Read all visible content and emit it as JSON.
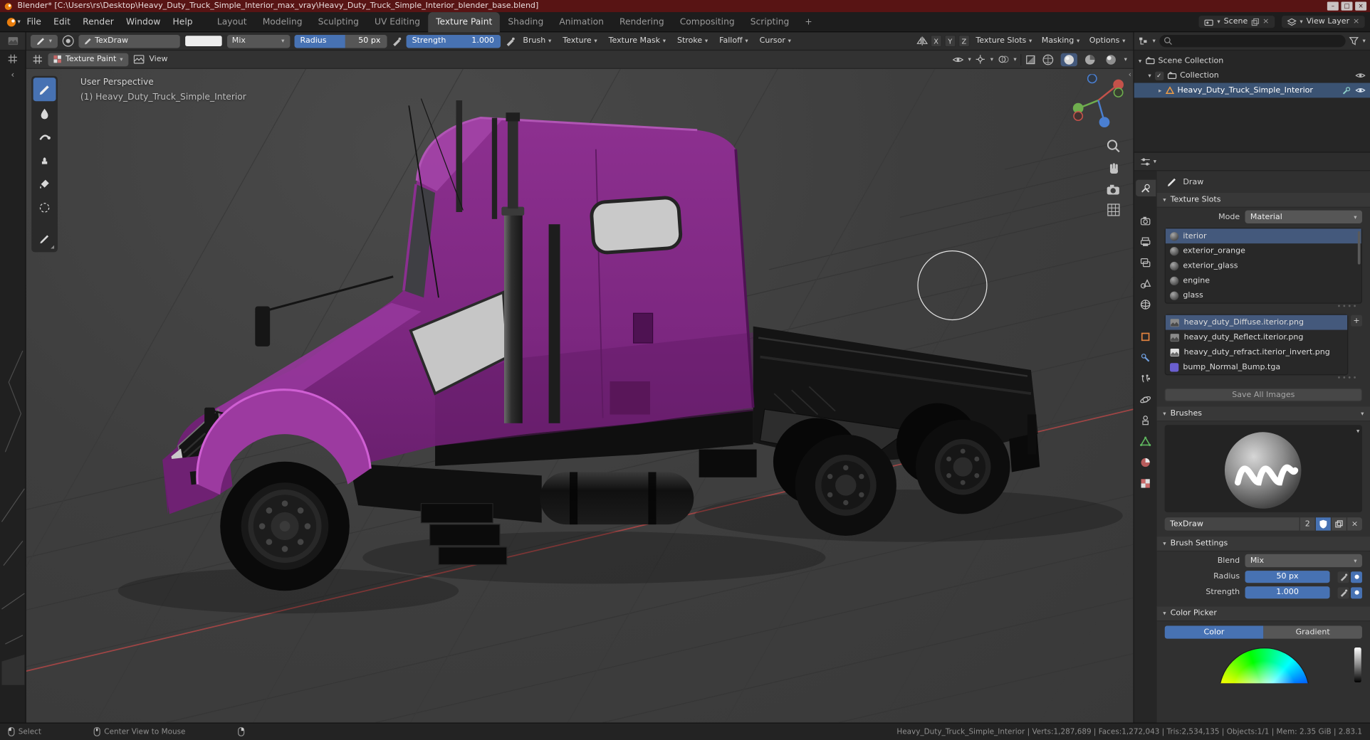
{
  "window": {
    "title": "Blender* [C:\\Users\\rs\\Desktop\\Heavy_Duty_Truck_Simple_Interior_max_vray\\Heavy_Duty_Truck_Simple_Interior_blender_base.blend]"
  },
  "icons": {
    "chevron_down": "▾",
    "chevron_right": "▸",
    "chevron_left": "‹",
    "plus": "+",
    "close": "×",
    "minimize": "–",
    "maximize": "□",
    "check": "✓",
    "grip": "∙∙∙∙"
  },
  "topbar": {
    "menus": [
      "File",
      "Edit",
      "Render",
      "Window",
      "Help"
    ],
    "workspaces": [
      "Layout",
      "Modeling",
      "Sculpting",
      "UV Editing",
      "Texture Paint",
      "Shading",
      "Animation",
      "Rendering",
      "Compositing",
      "Scripting"
    ],
    "add_workspace": "+",
    "scene": "Scene",
    "view_layer": "View Layer"
  },
  "tool_settings": {
    "brush_name": "TexDraw",
    "blend": "Mix",
    "radius_label": "Radius",
    "radius_value": "50 px",
    "strength_label": "Strength",
    "strength_value": "1.000",
    "popovers": [
      "Brush",
      "Texture",
      "Texture Mask",
      "Stroke",
      "Falloff",
      "Cursor"
    ],
    "symmetry": [
      "X",
      "Y",
      "Z"
    ],
    "right_popovers": [
      "Texture Slots",
      "Masking",
      "Options"
    ]
  },
  "viewport": {
    "mode": "Texture Paint",
    "view_menu": "View",
    "overlay_perspective": "User Perspective",
    "overlay_object": "(1) Heavy_Duty_Truck_Simple_Interior"
  },
  "outliner": {
    "rows": [
      {
        "label": "Scene Collection"
      },
      {
        "label": "Collection"
      },
      {
        "label": "Heavy_Duty_Truck_Simple_Interior"
      }
    ]
  },
  "properties": {
    "active_tool_label": "Draw",
    "texture_slots_panel": "Texture Slots",
    "mode_label": "Mode",
    "mode_value": "Material",
    "materials": [
      "iterior",
      "exterior_orange",
      "exterior_glass",
      "engine",
      "glass"
    ],
    "textures": [
      "heavy_duty_Diffuse.iterior.png",
      "heavy_duty_Reflect.iterior.png",
      "heavy_duty_refract.iterior_invert.png",
      "bump_Normal_Bump.tga"
    ],
    "save_all_images": "Save All Images",
    "brushes_panel": "Brushes",
    "brush_name": "TexDraw",
    "brush_users": "2",
    "brush_settings_panel": "Brush Settings",
    "blend_label": "Blend",
    "blend_value": "Mix",
    "radius_label": "Radius",
    "radius_value": "50 px",
    "strength_label": "Strength",
    "strength_value": "1.000",
    "color_picker_panel": "Color Picker",
    "color_button": "Color",
    "gradient_button": "Gradient"
  },
  "status_bar": {
    "select": "Select",
    "center_view": "Center View to Mouse",
    "stats": "Heavy_Duty_Truck_Simple_Interior | Verts:1,287,689 | Faces:1,272,043 | Tris:2,534,135 | Objects:1/1 | Mem: 2.35 GiB | 2.83.1"
  },
  "colors": {
    "accent": "#4772b3",
    "selection": "#3b5373",
    "truck_body": "#7c2780",
    "titlebar_bg": "#581414"
  }
}
